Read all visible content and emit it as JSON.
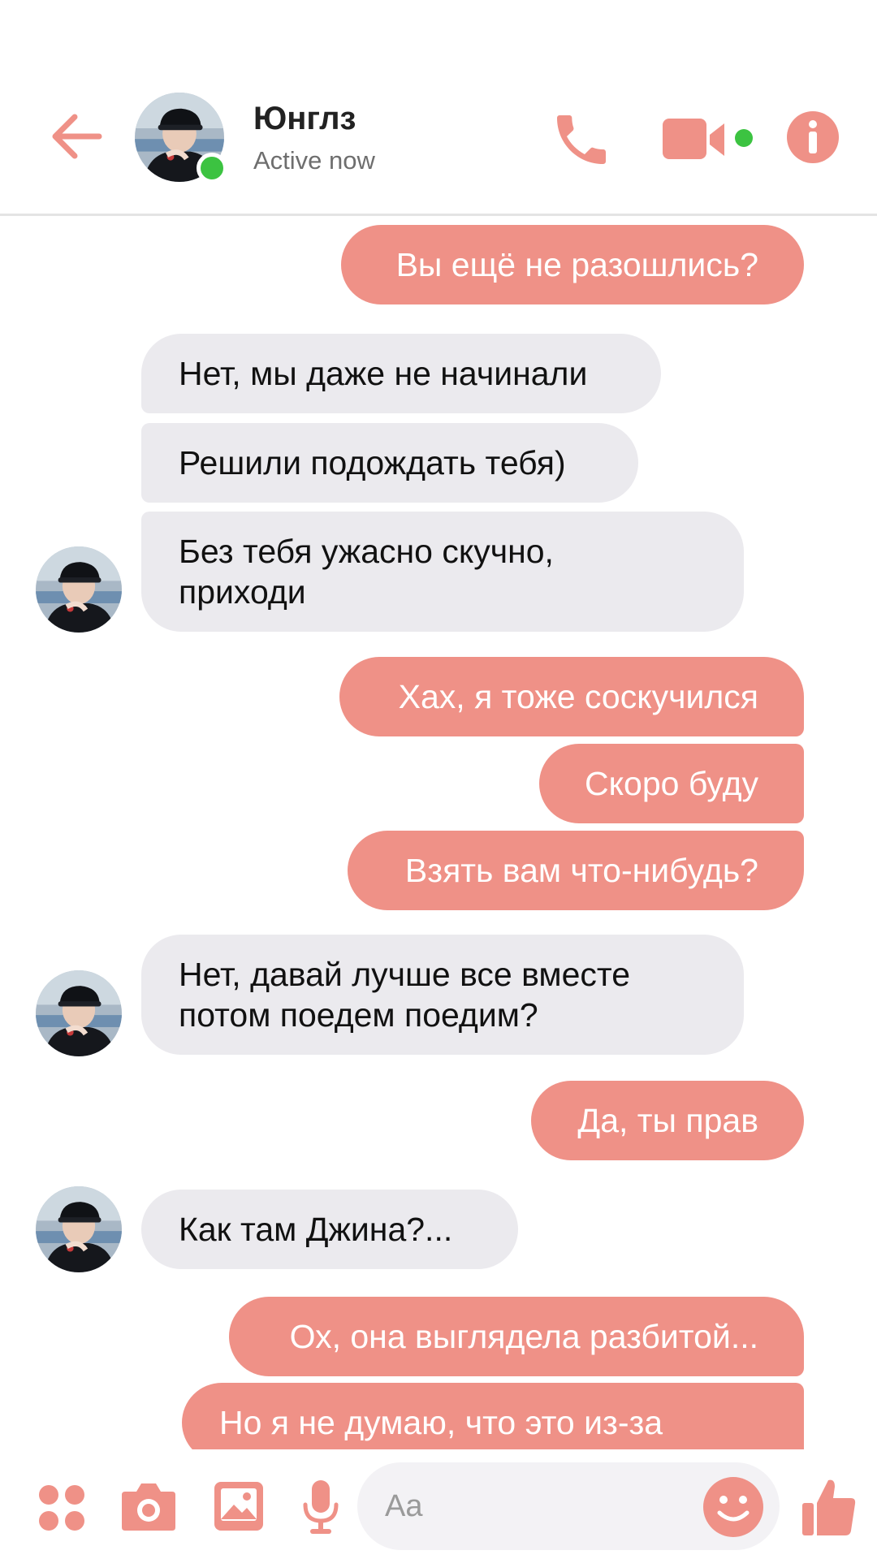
{
  "header": {
    "contact_name": "Юнглз",
    "status": "Active now"
  },
  "colors": {
    "accent": "#ef9187",
    "incoming_bubble": "#ebeaee",
    "online": "#3cc341"
  },
  "icons": {
    "back": "arrow-left-icon",
    "call": "phone-icon",
    "video": "video-camera-icon",
    "info": "info-icon",
    "apps": "four-dots-icon",
    "camera": "camera-icon",
    "gallery": "image-icon",
    "mic": "microphone-icon",
    "emoji": "smiley-icon",
    "like": "thumbs-up-icon"
  },
  "messages": [
    {
      "direction": "outgoing",
      "text": "Вы ещё не разошлись?"
    },
    {
      "direction": "incoming",
      "text": "Нет, мы даже не начинали"
    },
    {
      "direction": "incoming",
      "text": "Решили подождать тебя)"
    },
    {
      "direction": "incoming",
      "lines": [
        "Без тебя ужасно скучно,",
        "приходи"
      ]
    },
    {
      "direction": "outgoing",
      "text": "Хах, я тоже соскучился"
    },
    {
      "direction": "outgoing",
      "text": "Скоро буду"
    },
    {
      "direction": "outgoing",
      "text": "Взять вам что-нибудь?"
    },
    {
      "direction": "incoming",
      "lines": [
        "Нет, давай лучше все вместе",
        "потом поедем поедим?"
      ]
    },
    {
      "direction": "outgoing",
      "text": "Да, ты прав"
    },
    {
      "direction": "incoming",
      "text": "Как там Джина?..."
    },
    {
      "direction": "outgoing",
      "text": "Ох, она выглядела разбитой..."
    },
    {
      "direction": "outgoing",
      "text": "Но я не думаю, что это из-за"
    }
  ],
  "composer": {
    "placeholder": "Aa"
  }
}
